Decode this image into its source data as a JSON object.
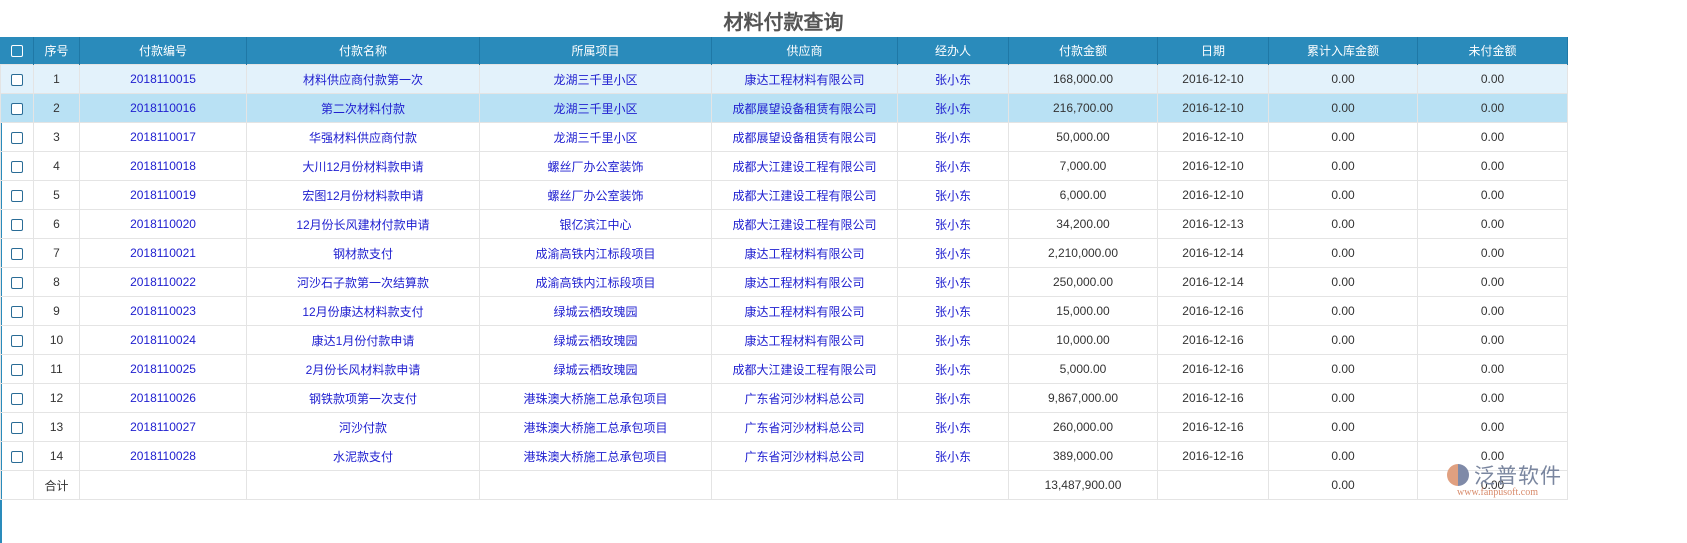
{
  "title": "材料付款查询",
  "columns": [
    "序号",
    "付款编号",
    "付款名称",
    "所属项目",
    "供应商",
    "经办人",
    "付款金额",
    "日期",
    "累计入库金额",
    "未付金额"
  ],
  "rows": [
    [
      "1",
      "2018110015",
      "材料供应商付款第一次",
      "龙湖三千里小区",
      "康达工程材料有限公司",
      "张小东",
      "168,000.00",
      "2016-12-10",
      "0.00",
      "0.00"
    ],
    [
      "2",
      "2018110016",
      "第二次材料付款",
      "龙湖三千里小区",
      "成都展望设备租赁有限公司",
      "张小东",
      "216,700.00",
      "2016-12-10",
      "0.00",
      "0.00"
    ],
    [
      "3",
      "2018110017",
      "华强材料供应商付款",
      "龙湖三千里小区",
      "成都展望设备租赁有限公司",
      "张小东",
      "50,000.00",
      "2016-12-10",
      "0.00",
      "0.00"
    ],
    [
      "4",
      "2018110018",
      "大川12月份材料款申请",
      "螺丝厂办公室装饰",
      "成都大江建设工程有限公司",
      "张小东",
      "7,000.00",
      "2016-12-10",
      "0.00",
      "0.00"
    ],
    [
      "5",
      "2018110019",
      "宏图12月份材料款申请",
      "螺丝厂办公室装饰",
      "成都大江建设工程有限公司",
      "张小东",
      "6,000.00",
      "2016-12-10",
      "0.00",
      "0.00"
    ],
    [
      "6",
      "2018110020",
      "12月份长风建材付款申请",
      "银亿滨江中心",
      "成都大江建设工程有限公司",
      "张小东",
      "34,200.00",
      "2016-12-13",
      "0.00",
      "0.00"
    ],
    [
      "7",
      "2018110021",
      "钢材款支付",
      "成渝高铁内江标段项目",
      "康达工程材料有限公司",
      "张小东",
      "2,210,000.00",
      "2016-12-14",
      "0.00",
      "0.00"
    ],
    [
      "8",
      "2018110022",
      "河沙石子款第一次结算款",
      "成渝高铁内江标段项目",
      "康达工程材料有限公司",
      "张小东",
      "250,000.00",
      "2016-12-14",
      "0.00",
      "0.00"
    ],
    [
      "9",
      "2018110023",
      "12月份康达材料款支付",
      "绿城云栖玫瑰园",
      "康达工程材料有限公司",
      "张小东",
      "15,000.00",
      "2016-12-16",
      "0.00",
      "0.00"
    ],
    [
      "10",
      "2018110024",
      "康达1月份付款申请",
      "绿城云栖玫瑰园",
      "康达工程材料有限公司",
      "张小东",
      "10,000.00",
      "2016-12-16",
      "0.00",
      "0.00"
    ],
    [
      "11",
      "2018110025",
      "2月份长风材料款申请",
      "绿城云栖玫瑰园",
      "成都大江建设工程有限公司",
      "张小东",
      "5,000.00",
      "2016-12-16",
      "0.00",
      "0.00"
    ],
    [
      "12",
      "2018110026",
      "钢铁款项第一次支付",
      "港珠澳大桥施工总承包项目",
      "广东省河沙材料总公司",
      "张小东",
      "9,867,000.00",
      "2016-12-16",
      "0.00",
      "0.00"
    ],
    [
      "13",
      "2018110027",
      "河沙付款",
      "港珠澳大桥施工总承包项目",
      "广东省河沙材料总公司",
      "张小东",
      "260,000.00",
      "2016-12-16",
      "0.00",
      "0.00"
    ],
    [
      "14",
      "2018110028",
      "水泥款支付",
      "港珠澳大桥施工总承包项目",
      "广东省河沙材料总公司",
      "张小东",
      "389,000.00",
      "2016-12-16",
      "0.00",
      "0.00"
    ]
  ],
  "footer": {
    "label": "合计",
    "amount": "13,487,900.00",
    "stock": "0.00",
    "unpaid": "0.00"
  },
  "logo": {
    "name": "泛普软件",
    "url": "www.fanpusoft.com"
  }
}
